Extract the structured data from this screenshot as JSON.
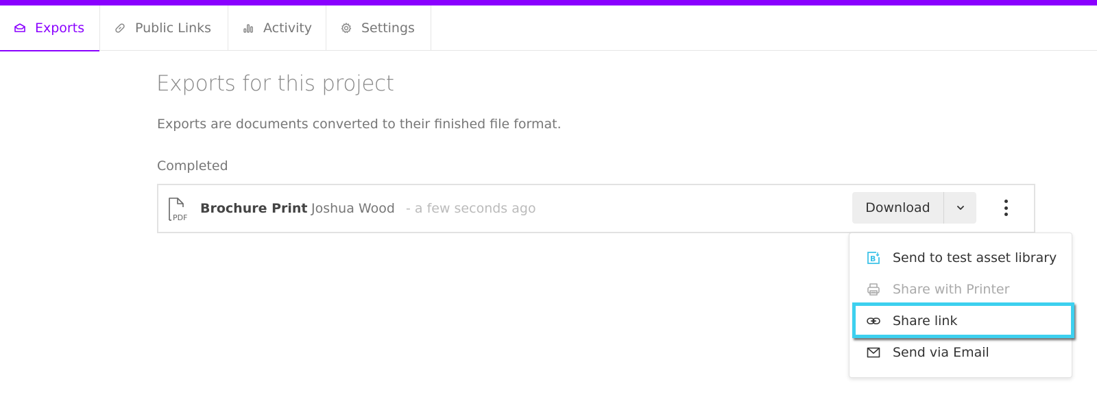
{
  "brand_color": "#8a00ff",
  "highlight_color": "#3dd0ef",
  "tabs": [
    {
      "label": "Exports",
      "icon": "inbox-icon",
      "active": true
    },
    {
      "label": "Public Links",
      "icon": "link-icon",
      "active": false
    },
    {
      "label": "Activity",
      "icon": "bar-chart-icon",
      "active": false
    },
    {
      "label": "Settings",
      "icon": "gear-icon",
      "active": false
    }
  ],
  "main": {
    "title": "Exports for this project",
    "description": "Exports are documents converted to their finished file format.",
    "section_label": "Completed"
  },
  "exports": [
    {
      "file_type": "PDF",
      "name": "Brochure Print",
      "user": "Joshua Wood",
      "time": "- a few seconds ago",
      "download_label": "Download"
    }
  ],
  "menu": {
    "items": [
      {
        "label": "Send to test asset library",
        "icon": "asset-library-icon",
        "disabled": false
      },
      {
        "label": "Share with Printer",
        "icon": "printer-icon",
        "disabled": true
      },
      {
        "label": "Share link",
        "icon": "link-icon",
        "disabled": false,
        "highlighted": true
      },
      {
        "label": "Send via Email",
        "icon": "mail-icon",
        "disabled": false
      }
    ]
  }
}
